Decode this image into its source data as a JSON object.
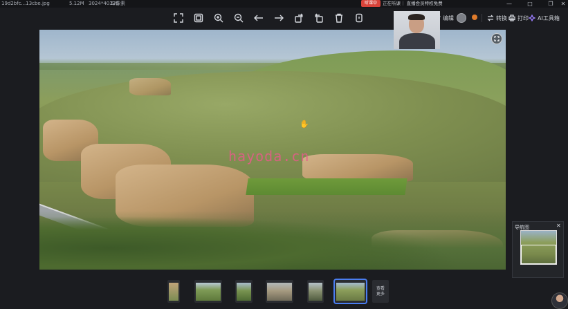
{
  "titlebar": {
    "filename": "19d2bfc...13cbe.jpg",
    "filesize": "5.12M",
    "dimensions": "3024*4032像素",
    "index": "5/6",
    "live_badge": "听课中",
    "live_text": "正在听课｜ 直播会员特权免费"
  },
  "toolbar": {
    "tools": [
      {
        "name": "fullscreen-icon"
      },
      {
        "name": "fit-window-icon"
      },
      {
        "name": "zoom-in-icon"
      },
      {
        "name": "zoom-out-icon"
      },
      {
        "name": "arrow-left-icon"
      },
      {
        "name": "arrow-right-icon"
      },
      {
        "name": "rotate-right-icon"
      },
      {
        "name": "rotate-left-icon"
      },
      {
        "name": "delete-icon"
      },
      {
        "name": "more-icon"
      }
    ]
  },
  "rightbar": {
    "edit_label": "编辑",
    "convert_label": "转换",
    "print_label": "打印",
    "ai_label": "AI工具箱"
  },
  "photo": {
    "watermark": "hayoda.cn"
  },
  "thumbnails": {
    "more_label": "查看",
    "more_label2": "更多"
  },
  "navigator": {
    "title": "导航图",
    "close": "✕"
  },
  "colors": {
    "accent": "#4a7df0",
    "badge": "#d8433a",
    "watermark": "#e65b8a"
  }
}
